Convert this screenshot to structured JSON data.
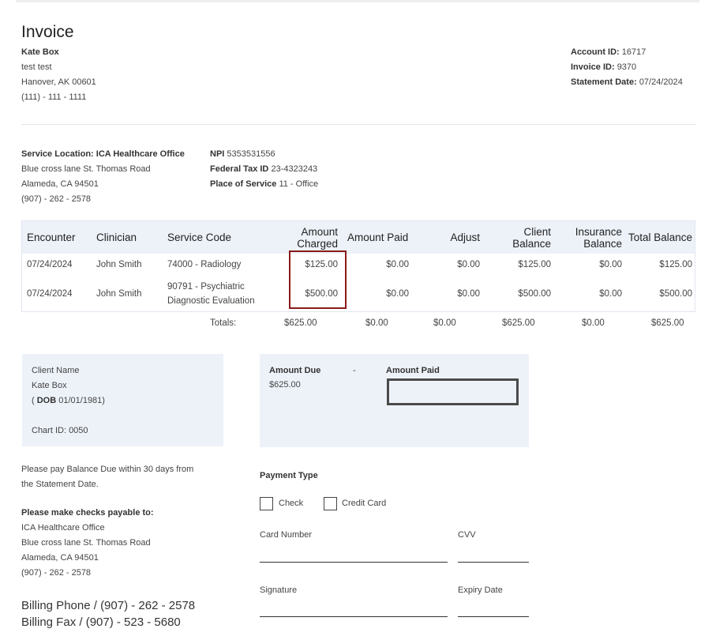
{
  "invoice": {
    "title": "Invoice",
    "client": {
      "name": "Kate Box",
      "line2": "test test",
      "address": "Hanover, AK 00601",
      "phone": "(111) - 111 - 1111"
    },
    "meta": [
      {
        "label": "Account ID:",
        "value": "16717"
      },
      {
        "label": "Invoice ID:",
        "value": "9370"
      },
      {
        "label": "Statement Date:",
        "value": "07/24/2024"
      }
    ]
  },
  "service_location": {
    "label": "Service Location:",
    "name": "ICA Healthcare Office",
    "street": "Blue cross lane St. Thomas Road",
    "city": "Alameda, CA 94501",
    "phone": "(907) - 262 - 2578"
  },
  "provider": [
    {
      "label": "NPI",
      "value": "5353531556"
    },
    {
      "label": "Federal Tax ID",
      "value": "23-4323243"
    },
    {
      "label": "Place of Service",
      "value": "11 - Office"
    }
  ],
  "table": {
    "headers": {
      "encounter": "Encounter",
      "clinician": "Clinician",
      "service_code": "Service Code",
      "amount_charged": [
        "Amount",
        "Charged"
      ],
      "amount_paid": "Amount Paid",
      "adjust": "Adjust",
      "client_balance": [
        "Client",
        "Balance"
      ],
      "insurance_balance": [
        "Insurance",
        "Balance"
      ],
      "total_balance": "Total Balance"
    },
    "rows": [
      {
        "encounter": "07/24/2024",
        "clinician": "John Smith",
        "service": [
          "74000 - Radiology"
        ],
        "charged": "$125.00",
        "paid": "$0.00",
        "adjust": "$0.00",
        "client_balance": "$125.00",
        "insurance_balance": "$0.00",
        "total": "$125.00"
      },
      {
        "encounter": "07/24/2024",
        "clinician": "John Smith",
        "service": [
          "90791 - Psychiatric",
          "Diagnostic Evaluation"
        ],
        "charged": "$500.00",
        "paid": "$0.00",
        "adjust": "$0.00",
        "client_balance": "$500.00",
        "insurance_balance": "$0.00",
        "total": "$500.00"
      }
    ],
    "totals": {
      "label": "Totals:",
      "charged": "$625.00",
      "paid": "$0.00",
      "adjust": "$0.00",
      "client_balance": "$625.00",
      "insurance_balance": "$0.00",
      "total": "$625.00"
    }
  },
  "client_panel": {
    "label": "Client Name",
    "name": "Kate Box",
    "dob_open": "( ",
    "dob_label": "DOB",
    "dob_value": " 01/01/1981)",
    "chart": "Chart ID: 0050"
  },
  "amount_panel": {
    "due_label": "Amount Due",
    "separator": "-",
    "paid_label": "Amount Paid",
    "due_value": "$625.00",
    "paid_input": ""
  },
  "notes": {
    "pay_within": [
      "Please pay Balance Due within 30 days from",
      "the Statement Date."
    ],
    "checks_label": "Please make checks payable to:",
    "payee": [
      "ICA Healthcare Office",
      "Blue cross lane St. Thomas Road",
      "Alameda, CA 94501",
      "(907) - 262 - 2578"
    ]
  },
  "payment": {
    "type_label": "Payment Type",
    "options": [
      "Check",
      "Credit Card"
    ],
    "card_number": "Card Number",
    "cvv": "CVV",
    "signature": "Signature",
    "expiry": "Expiry Date"
  },
  "billing": {
    "phone": "Billing Phone / (907) - 262 - 2578",
    "fax": "Billing Fax / (907) - 523 - 5680"
  },
  "colors": {
    "panel_bg": "#edf2f9",
    "highlight_border": "#8b1a1a"
  }
}
